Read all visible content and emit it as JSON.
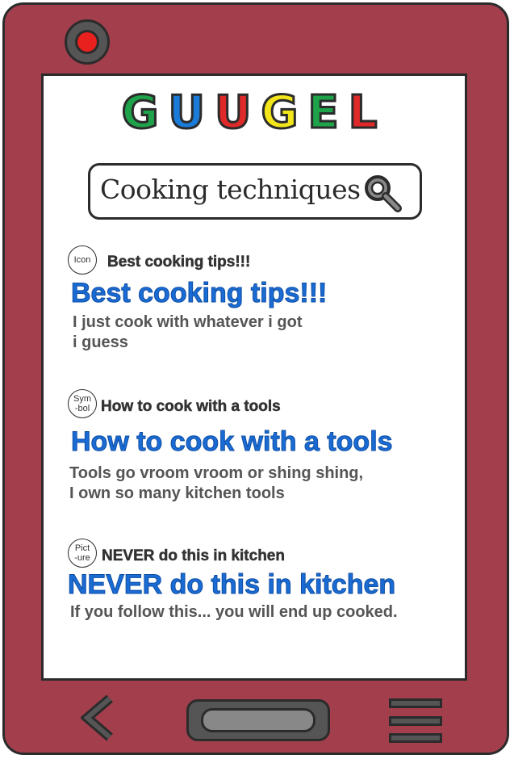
{
  "logo": {
    "letters": [
      {
        "char": "G",
        "color": "#1fa34a"
      },
      {
        "char": "U",
        "color": "#1a7bd8"
      },
      {
        "char": "U",
        "color": "#e02a2a"
      },
      {
        "char": "G",
        "color": "#f2e51a"
      },
      {
        "char": "E",
        "color": "#1fa34a"
      },
      {
        "char": "L",
        "color": "#e02a2a"
      }
    ]
  },
  "search": {
    "query": "Cooking techniques",
    "icon": "magnifier-icon"
  },
  "results": [
    {
      "favicon": "Icon",
      "site_name": "Best cooking tips!!!",
      "title": "Best cooking tips!!!",
      "desc_line1": "I just cook with whatever i got",
      "desc_line2": "i guess"
    },
    {
      "favicon": "Sym\n-bol",
      "site_name": "How to cook with a tools",
      "title": "How to cook with a tools",
      "desc_line1": "Tools go vroom vroom or shing shing,",
      "desc_line2": "I own so many kitchen tools"
    },
    {
      "favicon": "Pict\n-ure",
      "site_name": "NEVER do this in kitchen",
      "title": "NEVER do this in kitchen",
      "desc_line1": "If you follow this... you will end up cooked.",
      "desc_line2": ""
    }
  ],
  "nav": {
    "back_icon": "chevron-left-icon",
    "home_icon": "home-button",
    "menu_icon": "menu-icon"
  },
  "colors": {
    "device": "#a33f4d",
    "link": "#1a6bd4",
    "camera": "#e8201e"
  }
}
